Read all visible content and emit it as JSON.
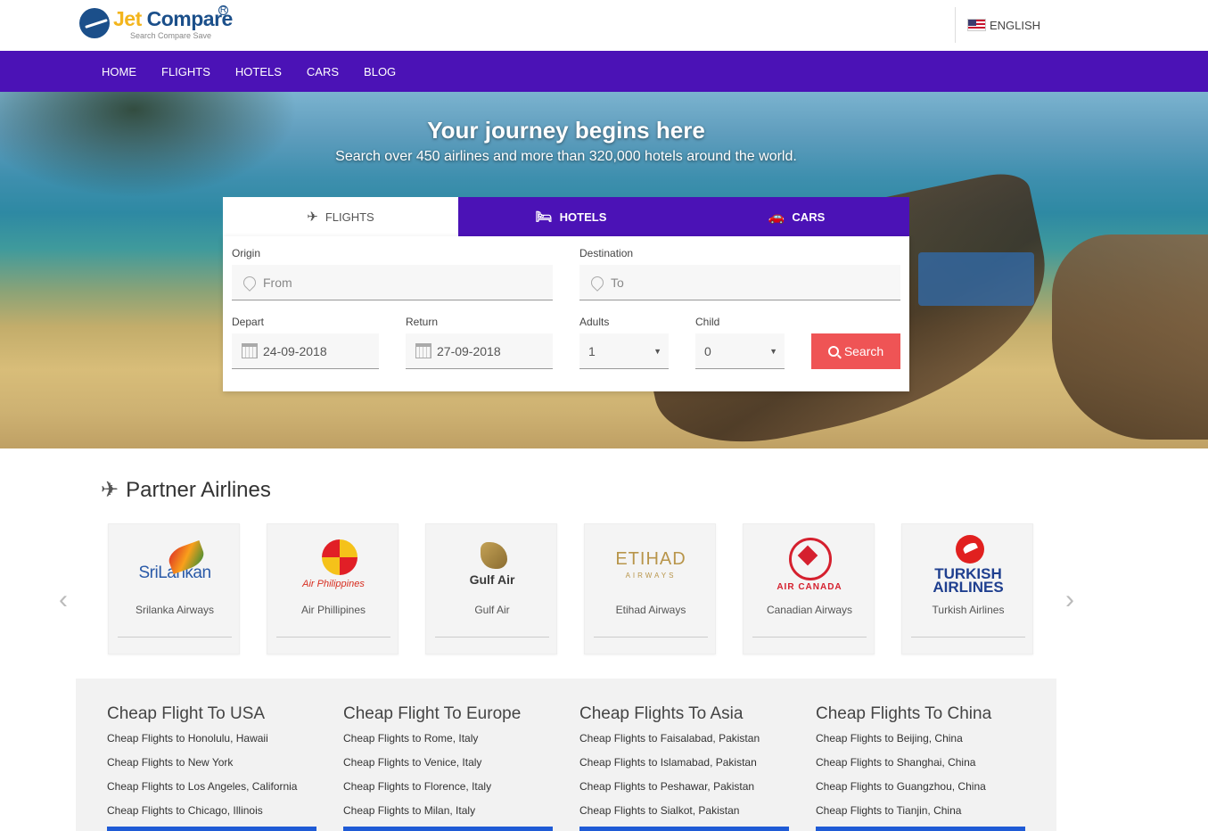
{
  "brand": {
    "name_part1": "Jet",
    "name_part2": "Compare",
    "reg": "R",
    "tagline": "Search Compare Save"
  },
  "language": {
    "label": "ENGLISH",
    "flag_icon": "us-flag-icon"
  },
  "nav": {
    "items": [
      "HOME",
      "FLIGHTS",
      "HOTELS",
      "CARS",
      "BLOG"
    ],
    "background": "#4b12b6"
  },
  "hero": {
    "title": "Your journey begins here",
    "subtitle": "Search over 450 airlines and more than 320,000 hotels around the world."
  },
  "search": {
    "tabs": [
      {
        "label": "FLIGHTS",
        "icon": "plane-icon",
        "active": true
      },
      {
        "label": "HOTELS",
        "icon": "bed-icon",
        "active": false
      },
      {
        "label": "CARS",
        "icon": "car-icon",
        "active": false
      }
    ],
    "origin": {
      "label": "Origin",
      "placeholder": "From"
    },
    "destination": {
      "label": "Destination",
      "placeholder": "To"
    },
    "depart": {
      "label": "Depart",
      "value": "24-09-2018"
    },
    "return": {
      "label": "Return",
      "value": "27-09-2018"
    },
    "adults": {
      "label": "Adults",
      "value": "1"
    },
    "child": {
      "label": "Child",
      "value": "0"
    },
    "search_button": "Search",
    "button_color": "#ef5455"
  },
  "partners": {
    "title": "Partner Airlines",
    "airlines": [
      {
        "name": "Srilanka Airways",
        "logo_text": "SriLankan"
      },
      {
        "name": "Air Phillipines",
        "logo_text": "Air Philippines"
      },
      {
        "name": "Gulf Air",
        "logo_text": "Gulf Air"
      },
      {
        "name": "Etihad Airways",
        "logo_text": "ETIHAD",
        "logo_sub": "AIRWAYS"
      },
      {
        "name": "Canadian Airways",
        "logo_text": "AIR CANADA"
      },
      {
        "name": "Turkish Airlines",
        "logo_text": "TURKISH",
        "logo_sub": "AIRLINES"
      }
    ]
  },
  "cheap_flights": [
    {
      "title": "Cheap Flight To USA",
      "links": [
        "Cheap Flights to Honolulu, Hawaii",
        "Cheap Flights to New York",
        "Cheap Flights to Los Angeles, California",
        "Cheap Flights to Chicago, Illinois"
      ]
    },
    {
      "title": "Cheap Flight To Europe",
      "links": [
        "Cheap Flights to Rome, Italy",
        "Cheap Flights to Venice, Italy",
        "Cheap Flights to Florence, Italy",
        "Cheap Flights to Milan, Italy"
      ]
    },
    {
      "title": "Cheap Flights To Asia",
      "links": [
        "Cheap Flights to Faisalabad, Pakistan",
        "Cheap Flights to Islamabad, Pakistan",
        "Cheap Flights to Peshawar, Pakistan",
        "Cheap Flights to Sialkot, Pakistan"
      ]
    },
    {
      "title": "Cheap Flights To China",
      "links": [
        "Cheap Flights to Beijing, China",
        "Cheap Flights to Shanghai, China",
        "Cheap Flights to Guangzhou, China",
        "Cheap Flights to Tianjin, China"
      ]
    }
  ]
}
